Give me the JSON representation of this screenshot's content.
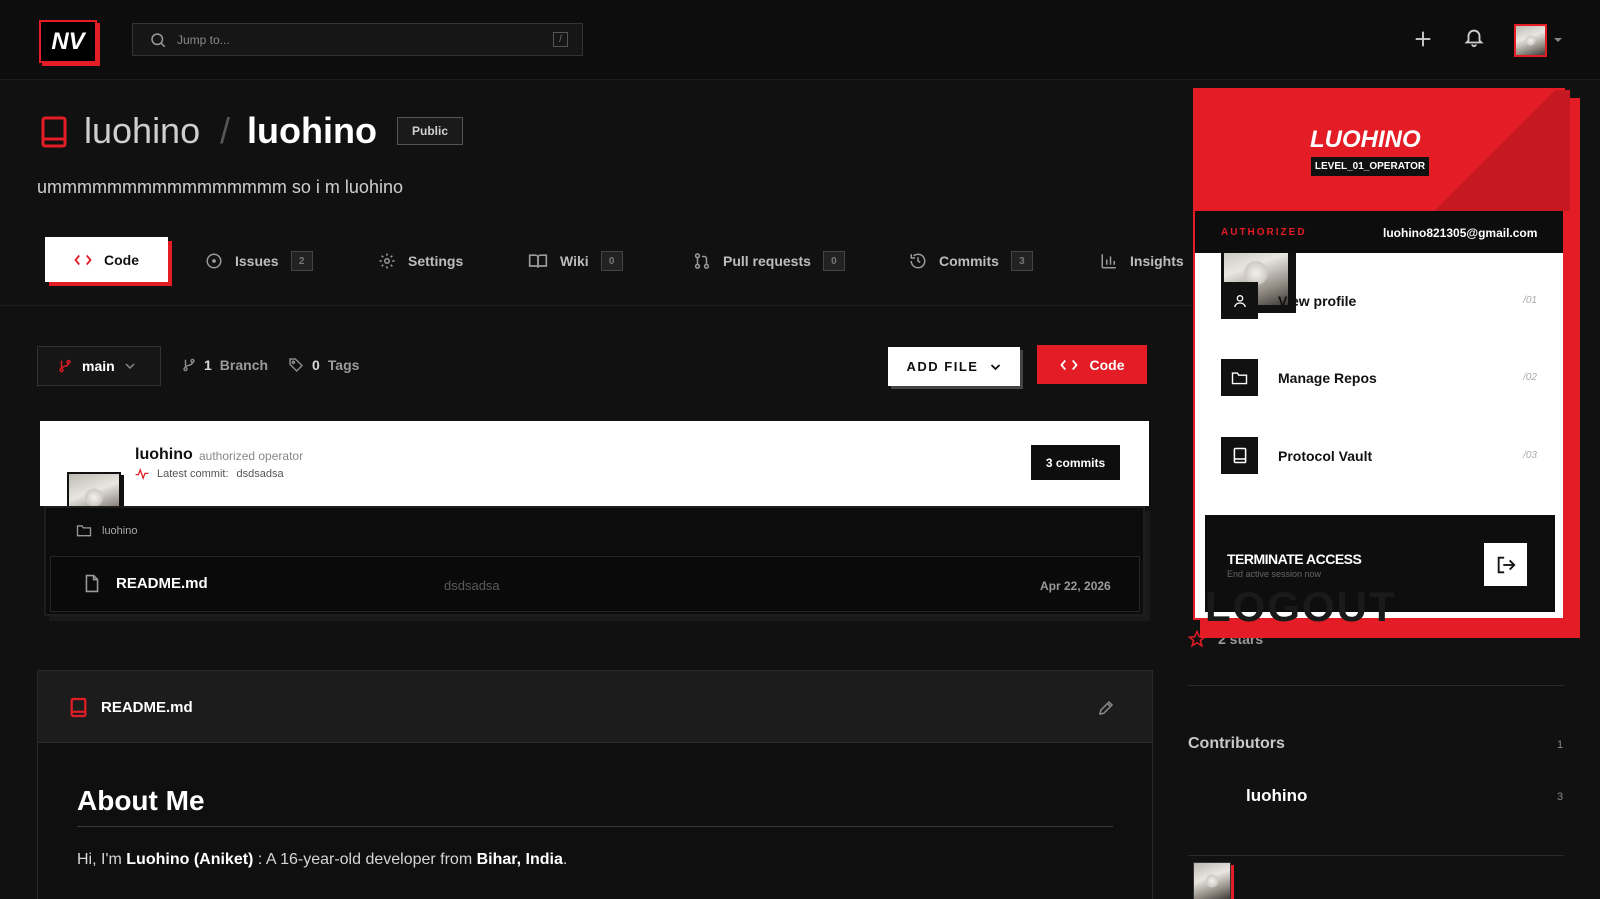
{
  "brand": {
    "logo_text": "NV",
    "accent_color": "#e31c25"
  },
  "search": {
    "placeholder": "Jump to...",
    "shortcut": "/"
  },
  "repo": {
    "owner": "luohino",
    "separator": "/",
    "name": "luohino",
    "visibility": "Public",
    "description": "ummmmmmmmmmmmmmmm so i m luohino"
  },
  "tabs": [
    {
      "label": "Code",
      "icon": "code-icon",
      "count": null
    },
    {
      "label": "Issues",
      "icon": "issue-icon",
      "count": "2"
    },
    {
      "label": "Settings",
      "icon": "gear-icon",
      "count": null
    },
    {
      "label": "Wiki",
      "icon": "book-icon",
      "count": "0"
    },
    {
      "label": "Pull requests",
      "icon": "pull-request-icon",
      "count": "0"
    },
    {
      "label": "Commits",
      "icon": "history-icon",
      "count": "3"
    },
    {
      "label": "Insights",
      "icon": "graph-icon",
      "count": null
    }
  ],
  "branch_bar": {
    "branch": "main",
    "branch_count": "1",
    "branch_label": "Branch",
    "tag_count": "0",
    "tag_label": "Tags",
    "add_file_label": "ADD FILE",
    "code_label": "Code"
  },
  "commit": {
    "author": "luohino",
    "role": "authorized operator",
    "latest_label": "Latest commit:",
    "latest_message": "dsdsadsa",
    "commits_label": "3 commits"
  },
  "files": {
    "folder": "luohino",
    "rows": [
      {
        "name": "README.md",
        "message": "dsdsadsa",
        "date": "Apr 22, 2026"
      }
    ]
  },
  "readme": {
    "filename": "README.md",
    "heading": "About Me",
    "intro_prefix": "Hi, I'm ",
    "intro_name": "Luohino (Aniket)",
    "intro_mid": " : A 16-year-old developer from ",
    "intro_place": "Bihar, India",
    "intro_suffix": "."
  },
  "sidebar": {
    "stars": "2 stars",
    "contributors_title": "Contributors",
    "contributors_count": "1",
    "contributors": [
      {
        "name": "luohino",
        "count": "3"
      }
    ]
  },
  "profile_menu": {
    "name": "LUOHINO",
    "level": "LEVEL_01_OPERATOR",
    "status": "AUTHORIZED",
    "email": "luohino821305@gmail.com",
    "items": [
      {
        "label": "View profile",
        "num": "/01",
        "icon": "user-icon"
      },
      {
        "label": "Manage Repos",
        "num": "/02",
        "icon": "folder-icon"
      },
      {
        "label": "Protocol Vault",
        "num": "/03",
        "icon": "vault-icon"
      }
    ],
    "terminate_title": "TERMINATE ACCESS",
    "terminate_sub": "End active session now",
    "terminate_ghost": "LOGOUT"
  }
}
